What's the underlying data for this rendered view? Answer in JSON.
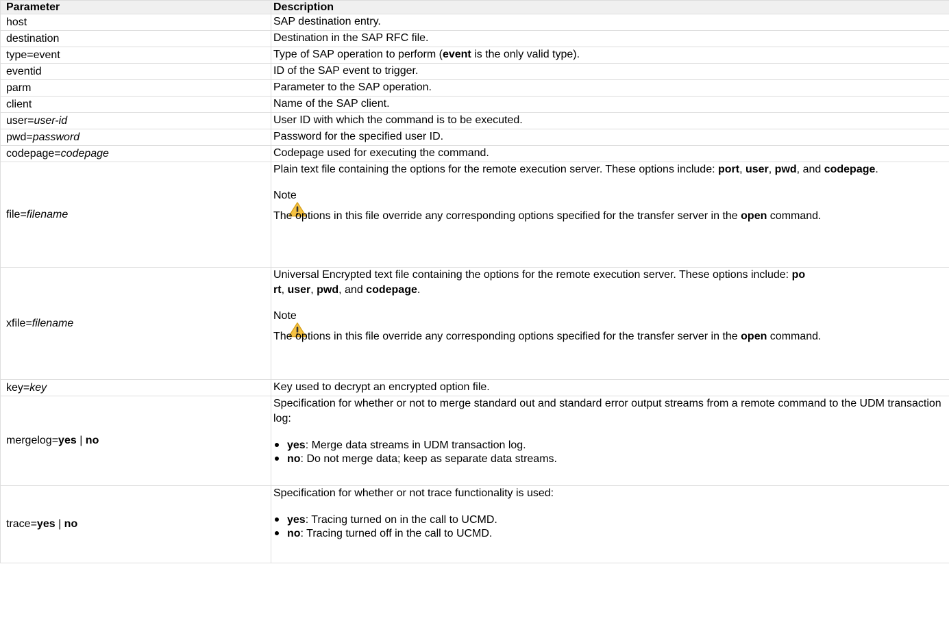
{
  "headers": {
    "parameter": "Parameter",
    "description": "Description"
  },
  "rows": {
    "host": {
      "param": "host",
      "desc": "SAP destination entry."
    },
    "destination": {
      "param": "destination",
      "desc": "Destination in the SAP RFC file."
    },
    "type": {
      "param": "type=event",
      "desc_pre": "Type of SAP operation to perform (",
      "desc_bold": "event",
      "desc_post": " is the only valid type)."
    },
    "eventid": {
      "param": "eventid",
      "desc": "ID of the SAP event to trigger."
    },
    "parm": {
      "param": "parm",
      "desc": "Parameter to the SAP operation."
    },
    "client": {
      "param": "client",
      "desc": "Name of the SAP client."
    },
    "user": {
      "param_pre": "user=",
      "param_italic": "user-id",
      "desc": "User ID with which the command is to be executed."
    },
    "pwd": {
      "param_pre": "pwd=",
      "param_italic": "password",
      "desc": "Password for the specified user ID."
    },
    "codepage": {
      "param_pre": "codepage=",
      "param_italic": "codepage",
      "desc": "Codepage used for executing the command."
    },
    "file": {
      "param_pre": "file=",
      "param_italic": "filename",
      "desc_pre": "Plain text file containing the options for the remote execution server. These options include: ",
      "opt_port": "port",
      "sep1": ", ",
      "opt_user": "user",
      "sep2": ", ",
      "opt_pwd": "pwd",
      "sep3": ", and ",
      "opt_codepage": "codepage",
      "desc_end": ".",
      "note_label": "Note",
      "note_pre": "The options in this file override any corresponding options specified for the transfer server in the ",
      "note_bold": "open",
      "note_post": " command."
    },
    "xfile": {
      "param_pre": "xfile=",
      "param_italic": "filename",
      "desc_pre": "Universal Encrypted text file containing the options for the remote execution server. These options include: ",
      "opt_port_a": "po",
      "opt_port_b": "rt",
      "sep1": ", ",
      "opt_user": "user",
      "sep2": ", ",
      "opt_pwd": "pwd",
      "sep3": ", and ",
      "opt_codepage": "codepage",
      "desc_end": ".",
      "note_label": "Note",
      "note_pre": "The options in this file override any corresponding options specified for the transfer server in the ",
      "note_bold": "open",
      "note_post": " command."
    },
    "key": {
      "param_pre": "key=",
      "param_italic": "key",
      "desc": "Key used to decrypt an encrypted option file."
    },
    "mergelog": {
      "param_pre": "mergelog=",
      "param_yes": "yes",
      "param_sep": " | ",
      "param_no": "no",
      "desc": "Specification for whether or not to merge standard out and standard error output streams from a remote command to the UDM transaction log:",
      "bullets": [
        {
          "bold": "yes",
          "text": ": Merge data streams in UDM transaction log."
        },
        {
          "bold": "no",
          "text": ": Do not merge data; keep as separate data streams."
        }
      ]
    },
    "trace": {
      "param_pre": "trace=",
      "param_yes": "yes",
      "param_sep": " | ",
      "param_no": "no",
      "desc": "Specification for whether or not trace functionality is used:",
      "bullets": [
        {
          "bold": "yes",
          "text": ": Tracing turned on in the call to UCMD."
        },
        {
          "bold": "no",
          "text": ": Tracing turned off in the call to UCMD."
        }
      ]
    }
  },
  "icons": {
    "warning": "warning-icon"
  },
  "colors": {
    "border": "#dddddd",
    "header_bg": "#f0f0f0",
    "warning_fill": "#f5c242",
    "warning_stroke": "#d8a21e"
  }
}
